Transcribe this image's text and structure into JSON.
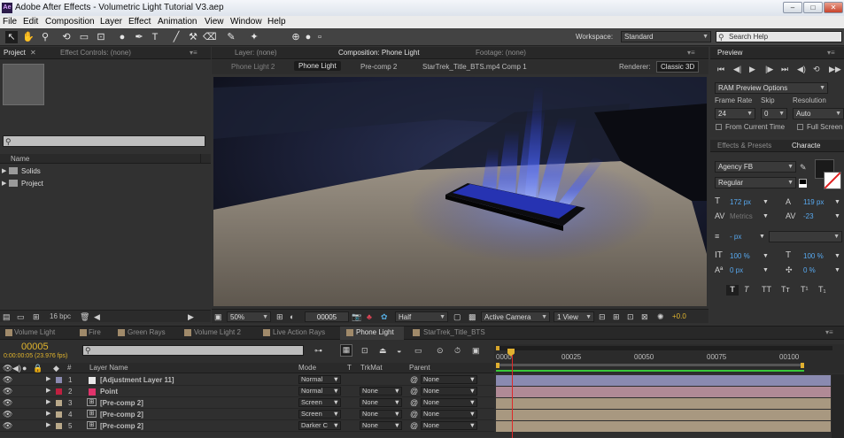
{
  "app": {
    "title": "Adobe After Effects - Volumetric Light Tutorial V3.aep",
    "logo_text": "Ae",
    "window_controls": [
      "–",
      "□",
      "✕"
    ]
  },
  "menu": [
    "File",
    "Edit",
    "Composition",
    "Layer",
    "Effect",
    "Animation",
    "View",
    "Window",
    "Help"
  ],
  "toolbar": {
    "workspace_label": "Workspace:",
    "workspace_value": "Standard",
    "search_placeholder": "Search Help"
  },
  "project_panel": {
    "tabs": [
      "Project",
      "Effect Controls: (none)"
    ],
    "search_placeholder": "",
    "column_name": "Name",
    "items": [
      "Solids",
      "Project"
    ],
    "bpc": "16 bpc"
  },
  "viewer": {
    "tabs": [
      "Layer: (none)",
      "Composition: Phone Light",
      "Footage: (none)"
    ],
    "breadcrumbs": [
      "Phone Light 2",
      "Phone Light",
      "Pre-comp 2",
      "StarTrek_Title_BTS.mp4 Comp 1"
    ],
    "active_breadcrumb": "Phone Light",
    "renderer_label": "Renderer:",
    "renderer_value": "Classic 3D",
    "zoom": "50%",
    "timecode": "00005",
    "resolution": "Half",
    "camera": "Active Camera",
    "views": "1 View",
    "exposure": "+0.0"
  },
  "preview_panel": {
    "title": "Preview",
    "ram_preview": "RAM Preview Options",
    "frame_rate_label": "Frame Rate",
    "skip_label": "Skip",
    "resolution_label": "Resolution",
    "frame_rate": "24",
    "skip": "0",
    "resolution": "Auto",
    "from_current_time": "From Current Time",
    "full_screen": "Full Screen"
  },
  "character_panel": {
    "tabs": [
      "Effects & Presets",
      "Characte"
    ],
    "font": "Agency FB",
    "style": "Regular",
    "size": "172 px",
    "leading": "119 px",
    "kerning": "Metrics",
    "tracking": "-23",
    "stroke": "- px",
    "vscale": "100 %",
    "hscale": "100 %",
    "baseline": "0 px",
    "tsume": "0 %",
    "style_buttons": [
      "T",
      "T",
      "TT",
      "Tт",
      "T¹",
      "T₁"
    ]
  },
  "timeline": {
    "tabs": [
      "Volume Light",
      "Fire",
      "Green Rays",
      "Volume Light 2",
      "Live Action Rays",
      "Phone Light",
      "StarTrek_Title_BTS"
    ],
    "active_tab": "Phone Light",
    "current_time": "00005",
    "time_info": "0:00:00:05 (23.976 fps)",
    "search_placeholder": "",
    "columns": {
      "num": "#",
      "layer_name": "Layer Name",
      "mode": "Mode",
      "t": "T",
      "trkmat": "TrkMat",
      "parent": "Parent"
    },
    "ruler": [
      "0000",
      "00025",
      "00050",
      "00075",
      "00100"
    ],
    "layers": [
      {
        "num": "1",
        "name": "[Adjustment Layer 11]",
        "color": "#e8e8e8",
        "mode": "Normal",
        "trkmat": "",
        "parent": "None",
        "bar": "#8a8ab0"
      },
      {
        "num": "2",
        "name": "Point",
        "color": "#e0336b",
        "mode": "Normal",
        "trkmat": "None",
        "parent": "None",
        "bar": "#b08a96"
      },
      {
        "num": "3",
        "name": "[Pre-comp 2]",
        "color": "#b9a98a",
        "mode": "Screen",
        "trkmat": "None",
        "parent": "None",
        "bar": "#a89880"
      },
      {
        "num": "4",
        "name": "[Pre-comp 2]",
        "color": "#b9a98a",
        "mode": "Screen",
        "trkmat": "None",
        "parent": "None",
        "bar": "#a89880"
      },
      {
        "num": "5",
        "name": "[Pre-comp 2]",
        "color": "#b9a98a",
        "mode": "Darker C",
        "trkmat": "None",
        "parent": "None",
        "bar": "#a89880"
      }
    ]
  }
}
